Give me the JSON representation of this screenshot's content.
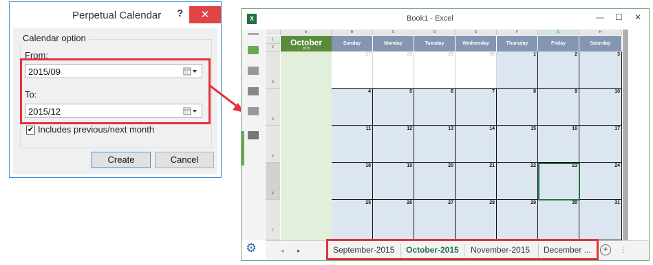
{
  "dialog": {
    "title": "Perpetual Calendar",
    "help": "?",
    "close": "✕",
    "group_label": "Calendar option",
    "from_label": "From:",
    "from_value": "2015/09",
    "to_label": "To:",
    "to_value": "2015/12",
    "include_label": "Includes previous/next month",
    "include_checked": "✔",
    "create_label": "Create",
    "cancel_label": "Cancel"
  },
  "excel": {
    "title": "Book1 - Excel",
    "logo": "X",
    "minimize": "—",
    "maximize": "☐",
    "close": "✕",
    "columns": [
      "A",
      "B",
      "C",
      "D",
      "E",
      "F",
      "G",
      "H"
    ],
    "rows": [
      "1",
      "2",
      "3",
      "4",
      "5",
      "6",
      "7"
    ],
    "month_name": "October",
    "month_year": "2015",
    "weekdays": [
      "Sunday",
      "Monday",
      "Tuesday",
      "Wednesday",
      "Thursday",
      "Friday",
      "Saturday"
    ],
    "weeks": [
      [
        "27",
        "28",
        "29",
        "30",
        "1",
        "2",
        "3"
      ],
      [
        "4",
        "5",
        "6",
        "7",
        "8",
        "9",
        "10"
      ],
      [
        "11",
        "12",
        "13",
        "14",
        "15",
        "16",
        "17"
      ],
      [
        "18",
        "19",
        "20",
        "21",
        "22",
        "23",
        "24"
      ],
      [
        "25",
        "26",
        "27",
        "28",
        "29",
        "30",
        "31"
      ]
    ],
    "tabs": [
      "September-2015",
      "October-2015",
      "November-2015",
      "December ..."
    ],
    "active_tab": "October-2015",
    "add_sheet": "+",
    "more": "⋮",
    "nav_prev": "◂",
    "nav_next": "▸",
    "settings_icon": "⚙"
  },
  "colors": {
    "highlight_red": "#e3313a",
    "excel_green": "#217346",
    "header_blue_gray": "#8496b0",
    "month_green": "#5a8b3a",
    "cell_blue": "#dce6f1"
  }
}
